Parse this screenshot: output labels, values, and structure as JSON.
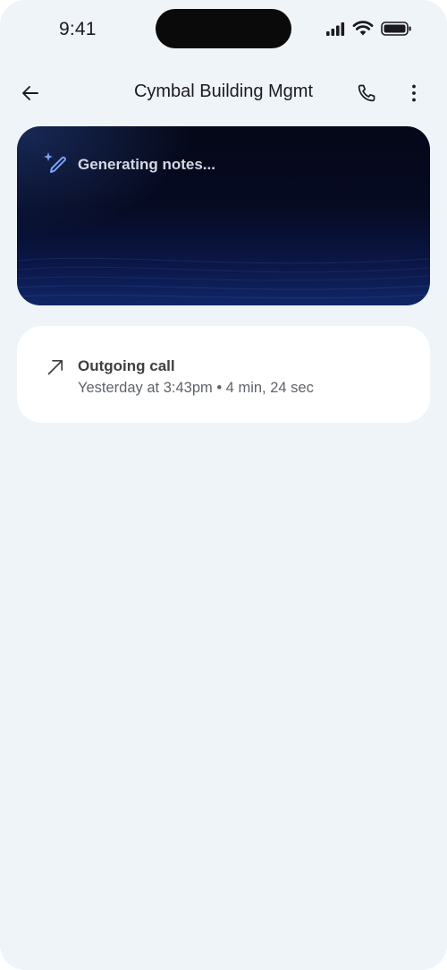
{
  "status_bar": {
    "time": "9:41",
    "icons": [
      "signal-icon",
      "wifi-icon",
      "battery-icon"
    ]
  },
  "app_bar": {
    "title": "Cymbal Building Mgmt",
    "icons": [
      "back-arrow-icon",
      "phone-icon",
      "more-vert-icon"
    ]
  },
  "notes_card": {
    "status_text": "Generating notes...",
    "icon": "sparkle-pen-icon",
    "accent_color": "#7aa2f7"
  },
  "call_card": {
    "icon": "outgoing-arrow-icon",
    "call_type": "Outgoing call",
    "details": "Yesterday at 3:43pm • 4 min, 24 sec"
  },
  "colors": {
    "background": "#eff4f9",
    "card": "#ffffff",
    "text_primary": "#1b1b1f",
    "text_secondary": "#5f6368"
  }
}
